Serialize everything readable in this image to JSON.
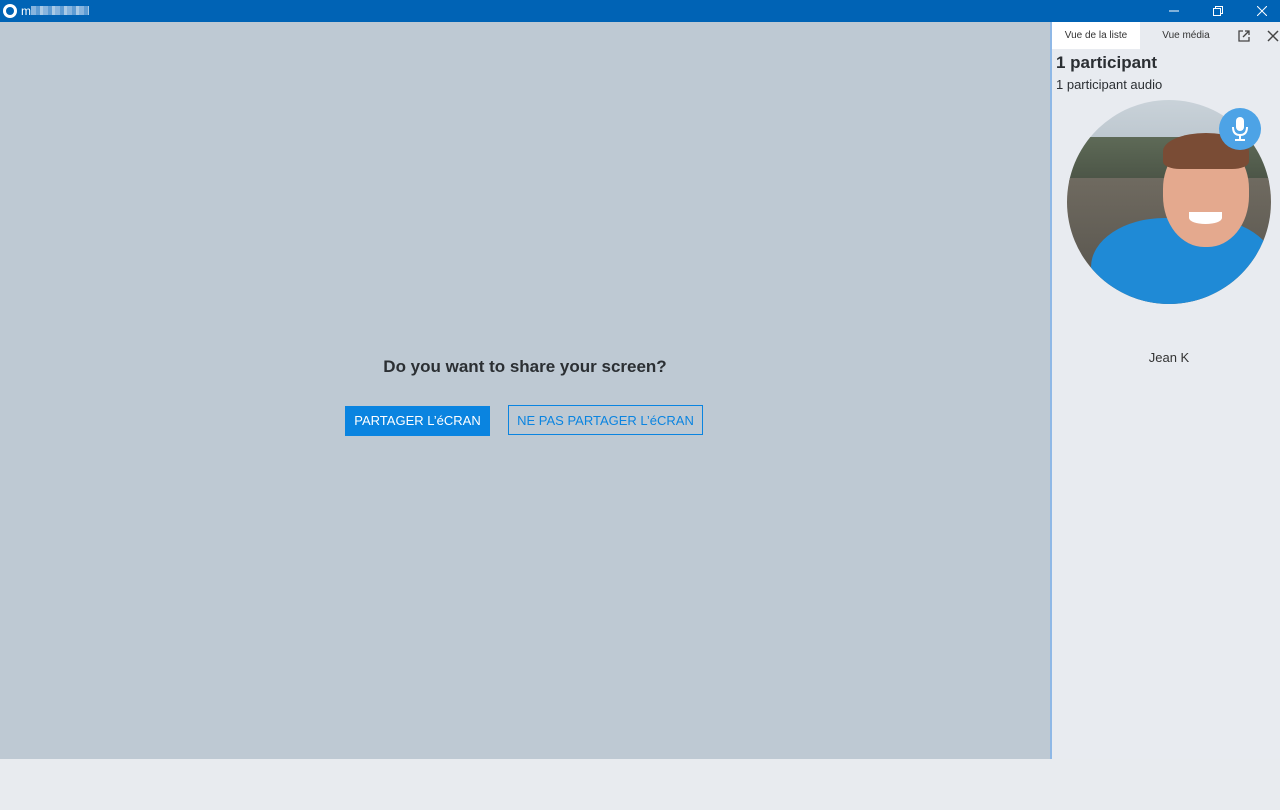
{
  "window": {
    "title": "m",
    "controls": [
      "minimize-icon",
      "restore-icon",
      "close-icon"
    ]
  },
  "main": {
    "prompt": "Do you want to share your screen?",
    "share_label": "PARTAGER L’éCRAN",
    "no_share_label": "NE PAS PARTAGER L’éCRAN"
  },
  "sidebar": {
    "tabs": [
      {
        "label": "Vue de la liste",
        "active": true
      },
      {
        "label": "Vue média",
        "active": false
      }
    ],
    "participant_count": "1 participant",
    "participant_audio": "1 participant audio",
    "participants": [
      {
        "name": "Jean K",
        "avatar": "photo",
        "status_icon": "microphone-icon"
      }
    ]
  },
  "colors": {
    "titlebar": "#0063b5",
    "main_bg": "#bec9d3",
    "accent": "#0a84e0",
    "sidebar_bg": "#e8ebf0"
  }
}
